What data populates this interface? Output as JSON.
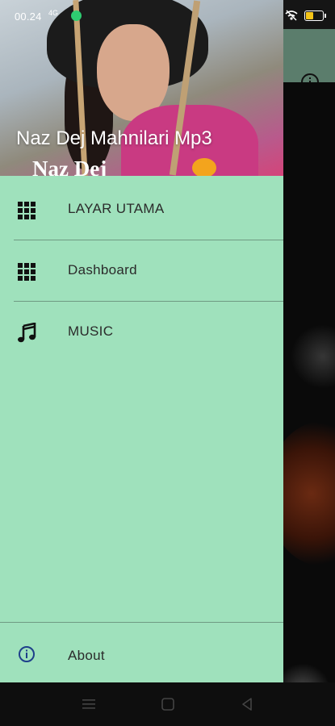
{
  "status_bar": {
    "time": "00.24",
    "network": "4G",
    "battery_color": "#f5c518"
  },
  "drawer": {
    "header_title": "Naz Dej Mahnilari Mp3",
    "header_image_text": "Naz Dej",
    "items": [
      {
        "label": "LAYAR UTAMA",
        "icon": "grid-icon"
      },
      {
        "label": "Dashboard",
        "icon": "grid-icon"
      },
      {
        "label": "MUSIC",
        "icon": "music-note-icon"
      }
    ],
    "footer_item": {
      "label": "About",
      "icon": "info-icon"
    },
    "background_color": "#9fe1bc"
  },
  "app_toolbar": {
    "background_color": "#5b7d6c",
    "action_icon": "info-icon"
  },
  "nav_bar": {
    "buttons": [
      "menu-icon",
      "home-icon",
      "back-icon"
    ]
  }
}
